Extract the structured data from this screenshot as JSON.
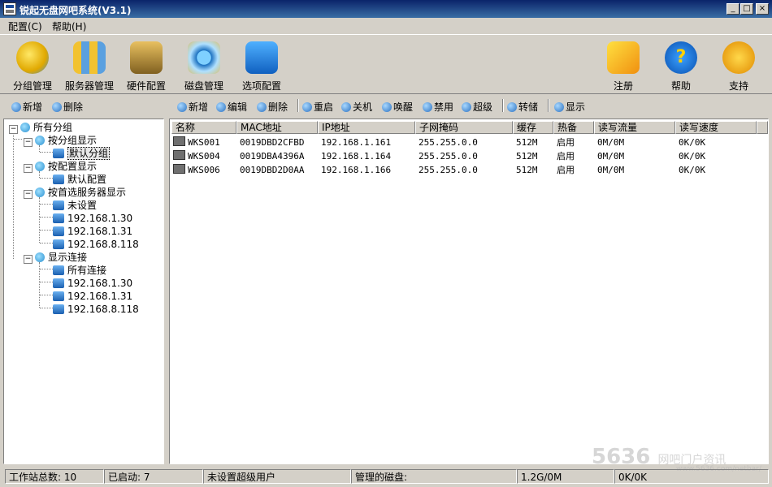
{
  "window": {
    "title": "锐起无盘网吧系统(V3.1)",
    "min": "_",
    "max": "□",
    "close": "×"
  },
  "menu": [
    "配置(C)",
    "帮助(H)"
  ],
  "toolbar_left": [
    "分组管理",
    "服务器管理",
    "硬件配置",
    "磁盘管理",
    "选项配置"
  ],
  "toolbar_right": [
    "注册",
    "帮助",
    "支持"
  ],
  "help_glyph": "?",
  "left_actions": [
    "新增",
    "删除"
  ],
  "right_actions": [
    "新增",
    "编辑",
    "删除",
    "重启",
    "关机",
    "唤醒",
    "禁用",
    "超级",
    "转储",
    "显示"
  ],
  "tree": {
    "root": "所有分组",
    "groups": [
      {
        "label": "按分组显示",
        "children": [
          "默认分组"
        ]
      },
      {
        "label": "按配置显示",
        "children": [
          "默认配置"
        ]
      },
      {
        "label": "按首选服务器显示",
        "children": [
          "未设置",
          "192.168.1.30",
          "192.168.1.31",
          "192.168.8.118"
        ]
      },
      {
        "label": "显示连接",
        "children": [
          "所有连接",
          "192.168.1.30",
          "192.168.1.31",
          "192.168.8.118"
        ]
      }
    ],
    "expander": "−"
  },
  "table": {
    "columns": [
      "名称",
      "MAC地址",
      "IP地址",
      "子网掩码",
      "缓存",
      "热备",
      "读写流量",
      "读写速度"
    ],
    "rows": [
      [
        "WKS001",
        "0019DBD2CFBD",
        "192.168.1.161",
        "255.255.0.0",
        "512M",
        "启用",
        "0M/0M",
        "0K/0K"
      ],
      [
        "WKS004",
        "0019DBA4396A",
        "192.168.1.164",
        "255.255.0.0",
        "512M",
        "启用",
        "0M/0M",
        "0K/0K"
      ],
      [
        "WKS006",
        "0019DBD2D0AA",
        "192.168.1.166",
        "255.255.0.0",
        "512M",
        "启用",
        "0M/0M",
        "0K/0K"
      ]
    ]
  },
  "status": {
    "workstations": "工作站总数: 10",
    "started": "已启动: 7",
    "superuser": "未设置超级用户",
    "managed_disk": "管理的磁盘:",
    "traffic": "1.2G/0M",
    "speed": "0K/0K"
  },
  "watermark": {
    "main": "5636",
    "sub": "网吧门户资讯",
    "url": "www.5636.com/netbar/"
  }
}
